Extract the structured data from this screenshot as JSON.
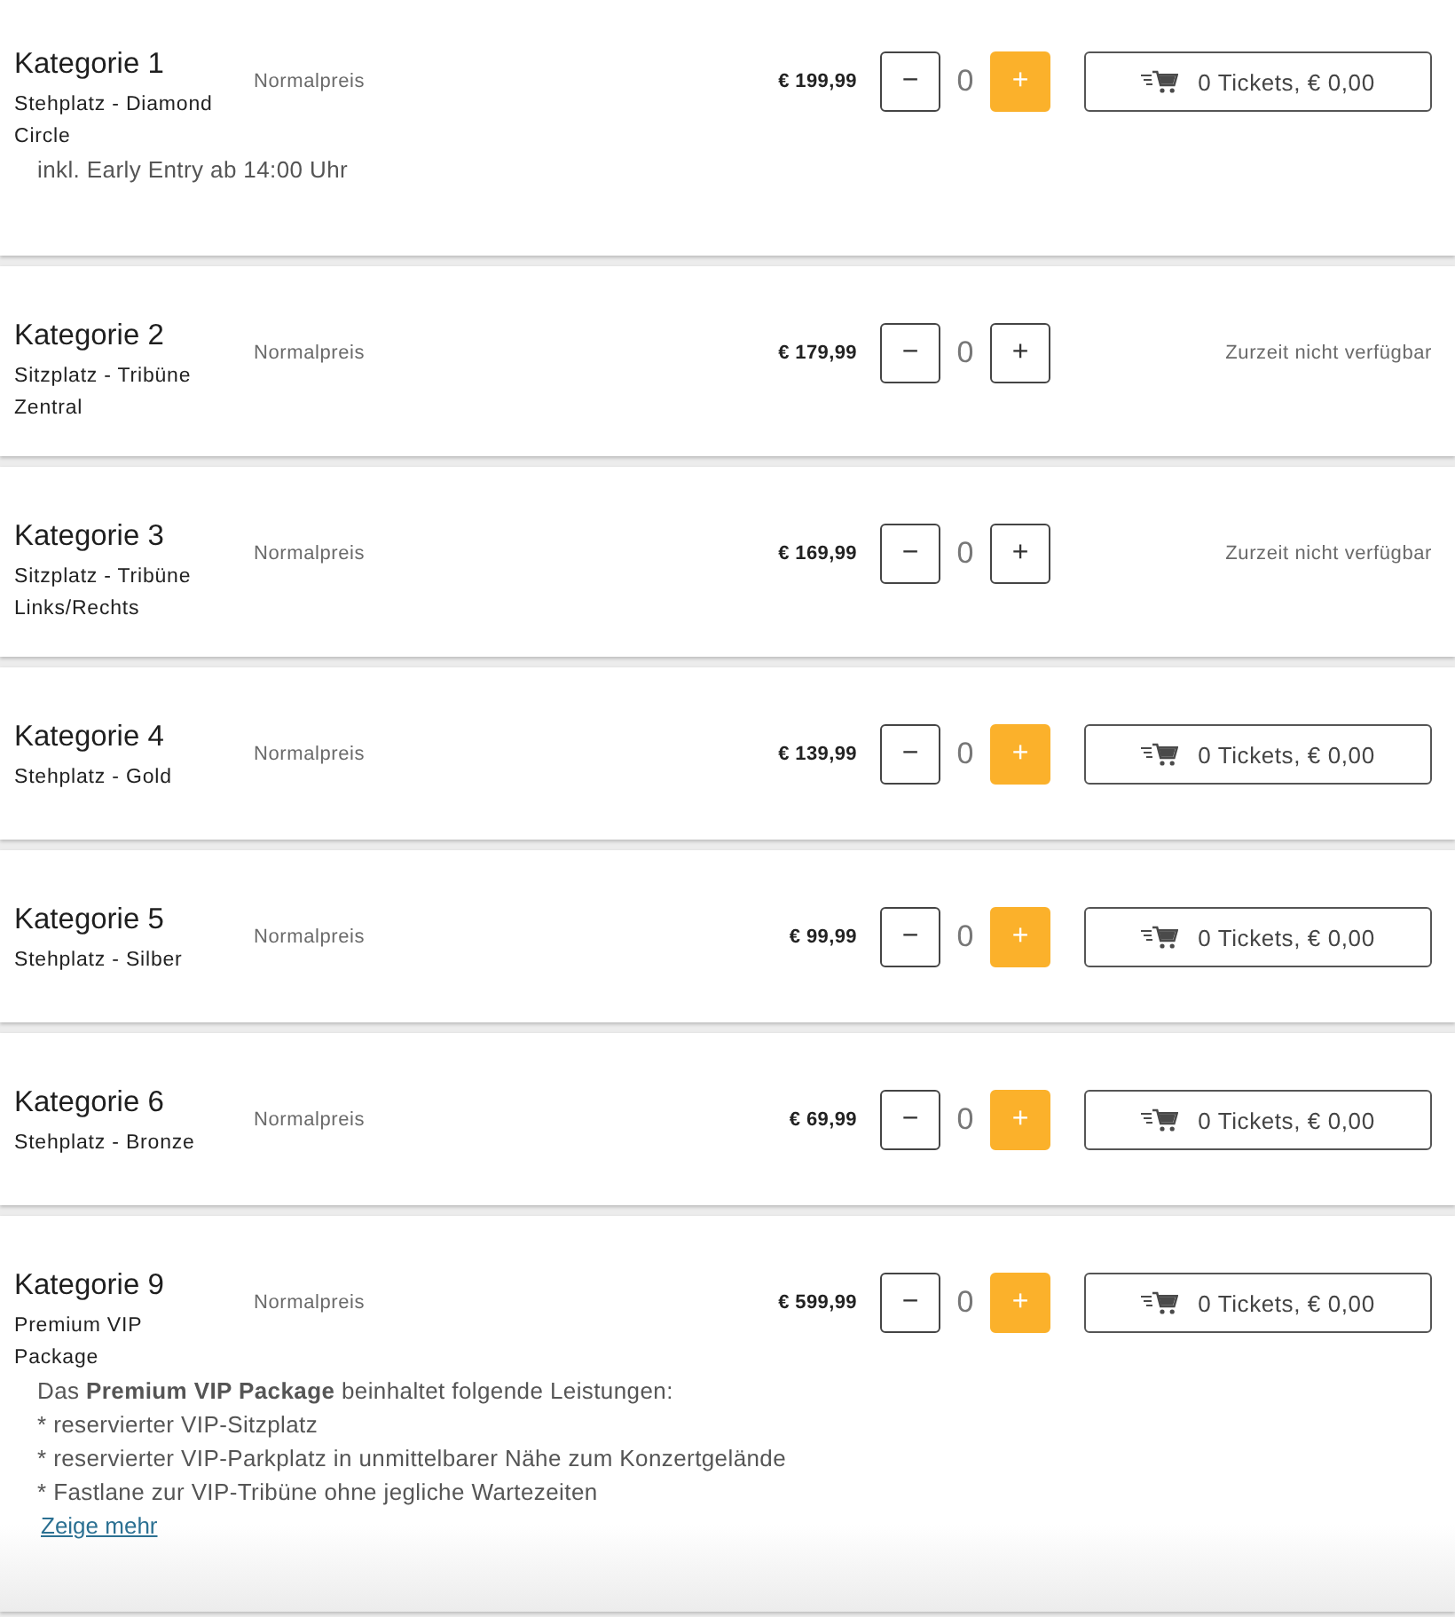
{
  "categories": [
    {
      "title": "Kategorie 1",
      "subtitle": "Stehplatz - Diamond Circle",
      "price_type": "Normalpreis",
      "price": "€ 199,99",
      "decrease": "−",
      "quantity": "0",
      "increase": "+",
      "available": true,
      "cart_label": "0 Tickets, € 0,00",
      "collapsed": false,
      "description": [
        "inkl. Early Entry ab 14:00 Uhr"
      ]
    },
    {
      "title": "Kategorie 2",
      "subtitle": "Sitzplatz - Tribüne Zentral",
      "price_type": "Normalpreis",
      "price": "€ 179,99",
      "decrease": "−",
      "quantity": "0",
      "increase": "+",
      "available": false,
      "status": "Zurzeit nicht verfügbar",
      "collapsed": false
    },
    {
      "title": "Kategorie 3",
      "subtitle": "Sitzplatz - Tribüne Links/Rechts",
      "price_type": "Normalpreis",
      "price": "€ 169,99",
      "decrease": "−",
      "quantity": "0",
      "increase": "+",
      "available": false,
      "status": "Zurzeit nicht verfügbar",
      "collapsed": false
    },
    {
      "title": "Kategorie 4",
      "subtitle": "Stehplatz - Gold",
      "price_type": "Normalpreis",
      "price": "€ 139,99",
      "decrease": "−",
      "quantity": "0",
      "increase": "+",
      "available": true,
      "cart_label": "0 Tickets, € 0,00",
      "collapsed": false
    },
    {
      "title": "Kategorie 5",
      "subtitle": "Stehplatz - Silber",
      "price_type": "Normalpreis",
      "price": "€ 99,99",
      "decrease": "−",
      "quantity": "0",
      "increase": "+",
      "available": true,
      "cart_label": "0 Tickets, € 0,00",
      "collapsed": false
    },
    {
      "title": "Kategorie 6",
      "subtitle": "Stehplatz - Bronze",
      "price_type": "Normalpreis",
      "price": "€ 69,99",
      "decrease": "−",
      "quantity": "0",
      "increase": "+",
      "available": true,
      "cart_label": "0 Tickets, € 0,00",
      "collapsed": false
    },
    {
      "title": "Kategorie 9",
      "subtitle": "Premium VIP Package",
      "price_type": "Normalpreis",
      "price": "€ 599,99",
      "decrease": "−",
      "quantity": "0",
      "increase": "+",
      "available": true,
      "cart_label": "0 Tickets, € 0,00",
      "collapsed": true,
      "description": [
        "Das **Premium VIP Package** beinhaltet folgende Leistungen:",
        "* reservierter VIP-Sitzplatz",
        "* reservierter VIP-Parkplatz in unmittelbarer Nähe zum Konzertgelände",
        "* Fastlane zur VIP-Tribüne ohne jegliche Wartezeiten"
      ],
      "more_link": "Zeige mehr"
    }
  ]
}
